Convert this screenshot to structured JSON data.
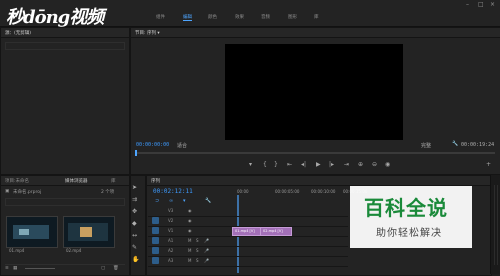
{
  "logo": {
    "text": "秒dōng视频"
  },
  "menu": {
    "items": [
      "组件",
      "编辑",
      "颜色",
      "效果",
      "音频",
      "图形",
      "库"
    ],
    "active_index": 1
  },
  "window": {
    "min": "–",
    "max": "□",
    "close": "×"
  },
  "source_panel": {
    "tab_label": "源：(无剪辑)",
    "header_icon": "panel-menu-icon"
  },
  "program_monitor": {
    "tab_label": "节目: 序列 ▾",
    "timecode_in": "00:00:00:00",
    "fit_label": "适合",
    "quality_label": "完整",
    "timecode_out": "00:00:19:24",
    "controls": [
      "marker",
      "in",
      "out",
      "go-in",
      "step-back",
      "play",
      "step-fwd",
      "go-out",
      "lift",
      "extract",
      "export-frame"
    ]
  },
  "project_panel": {
    "tabs": [
      "项目:未命名",
      "媒体浏览器",
      "库"
    ],
    "path": "未命名.prproj",
    "item_count": "2 个项",
    "thumbs": [
      {
        "label": "01.mp4"
      },
      {
        "label": "02.mp4"
      }
    ]
  },
  "timeline": {
    "tab_label": "序列",
    "timecode": "00:02:12:11",
    "ruler_marks": [
      "00:00",
      "00:00:05:00",
      "00:00:10:00",
      "00:00:15:00"
    ],
    "tracks": [
      {
        "name": "V3"
      },
      {
        "name": "V2"
      },
      {
        "name": "V1"
      },
      {
        "name": "A1"
      },
      {
        "name": "A2"
      },
      {
        "name": "A3"
      }
    ],
    "clips": [
      {
        "label": "01.mp4 [V]"
      },
      {
        "label": "02.mp4 [V]"
      }
    ]
  },
  "watermark": {
    "title": "百科全说",
    "subtitle": "助你轻松解决"
  },
  "colors": {
    "accent": "#4ea5ff",
    "timecode": "#3d9bff",
    "clip": "#a370b8",
    "watermark_green": "#1a8a3a"
  }
}
